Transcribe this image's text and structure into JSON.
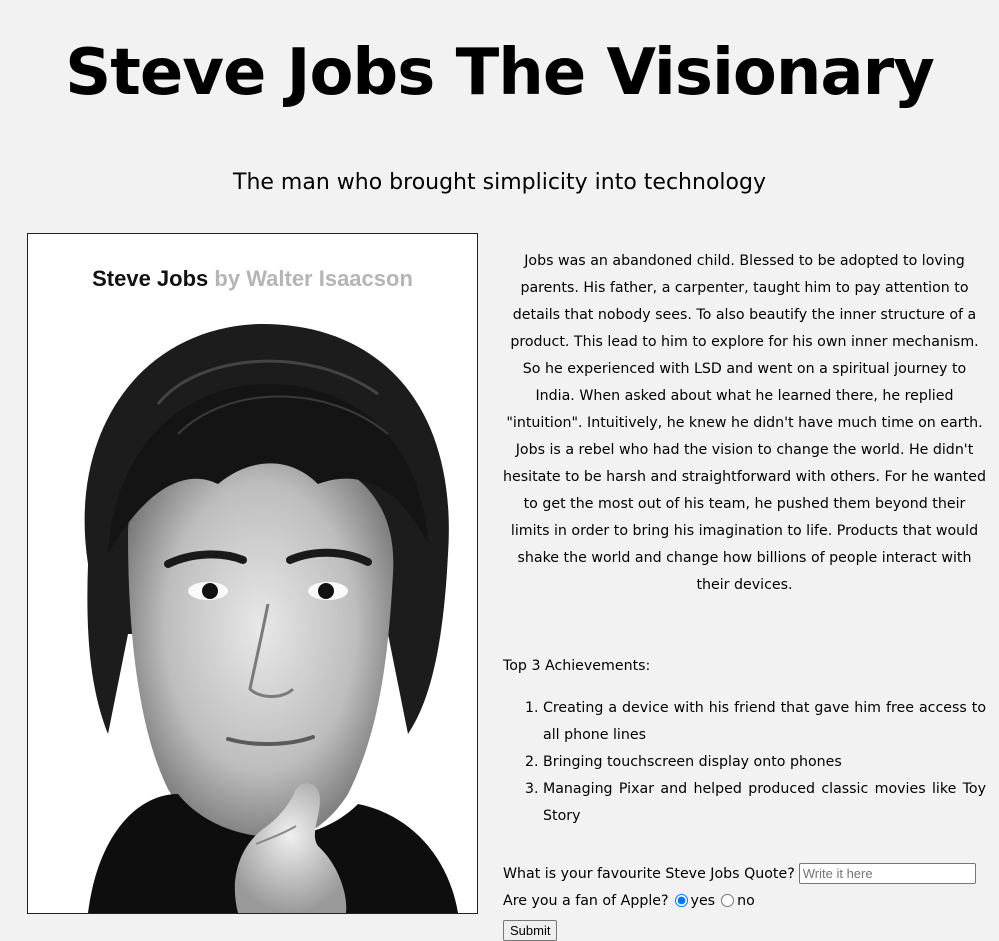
{
  "header": {
    "title": "Steve Jobs The Visionary",
    "subtitle": "The man who brought simplicity into technology"
  },
  "cover": {
    "title": "Steve Jobs",
    "byline": "by Walter Isaacson"
  },
  "bio": {
    "paragraph_1": "Jobs was an abandoned child. Blessed to be adopted to loving parents. His father, a carpenter, taught him to pay attention to details that nobody sees. To also beautify the inner structure of a product. This lead to him to explore for his own inner mechanism. So he experienced with LSD and went on a spiritual journey to India. When asked about what he learned there, he replied \"intuition\". Intuitively, he knew he didn't have much time on earth.",
    "paragraph_2": "Jobs is a rebel who had the vision to change the world. He didn't hesitate to be harsh and straightforward with others. For he wanted to get the most out of his team, he pushed them beyond their limits in order to bring his imagination to life. Products that would shake the world and change how billions of people interact with their devices."
  },
  "achievements": {
    "heading": "Top 3 Achievements:",
    "items": [
      "Creating a device with his friend that gave him free access to all phone lines",
      "Bringing touchscreen display onto phones",
      "Managing Pixar and helped produced classic movies like Toy Story"
    ]
  },
  "form": {
    "quote_label": "What is your favourite Steve Jobs Quote?",
    "quote_placeholder": "Write it here",
    "quote_value": "",
    "fan_label": "Are you a fan of Apple?",
    "option_yes": "yes",
    "option_no": "no",
    "selected": "yes",
    "submit_label": "Submit"
  },
  "colors": {
    "background": "#f2f2f2",
    "radio_accent": "#0075ff",
    "byline_gray": "#b5b5b5"
  }
}
